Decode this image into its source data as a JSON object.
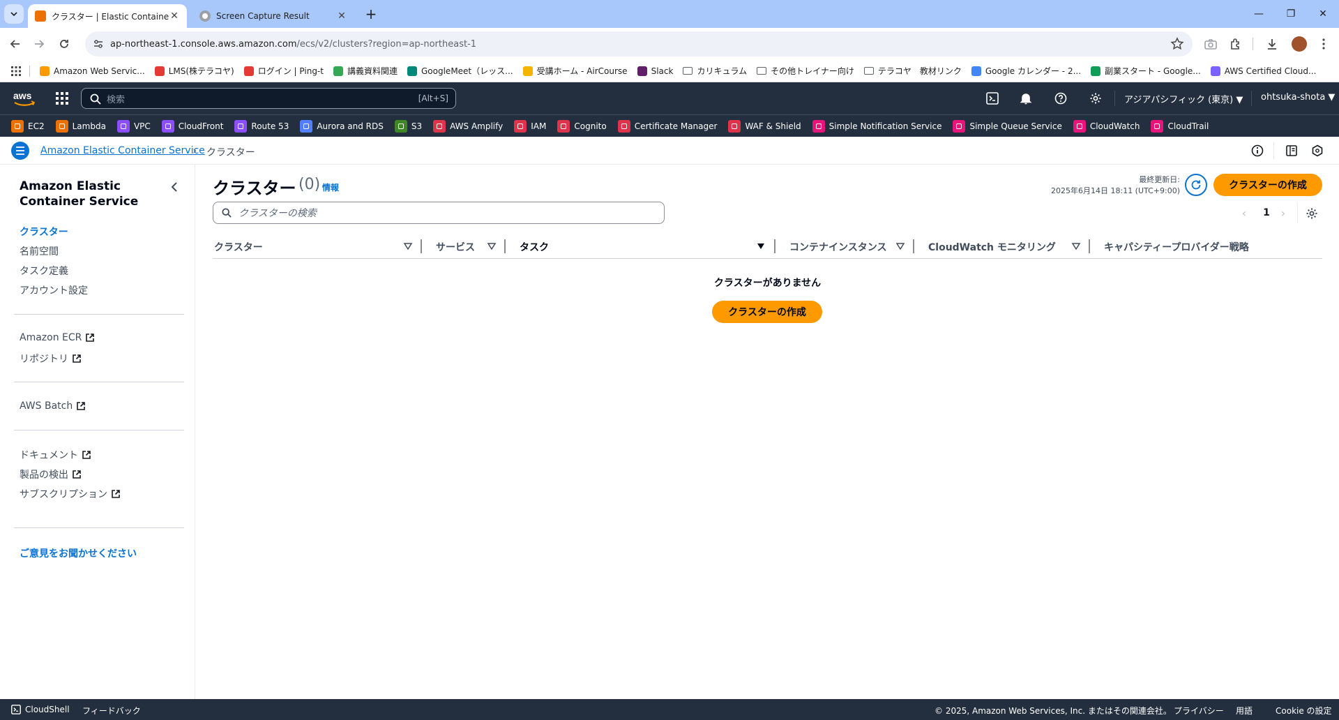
{
  "browser": {
    "tabs": [
      {
        "title": "クラスター | Elastic Container Servi",
        "active": true
      },
      {
        "title": "Screen Capture Result",
        "active": false
      }
    ],
    "url_host": "ap-northeast-1.console.aws.amazon.com",
    "url_path": "/ecs/v2/clusters?region=ap-northeast-1",
    "bookmarks": [
      {
        "label": "Amazon Web Servic...",
        "icon": "aws-cube-icon",
        "color": "#ff9900"
      },
      {
        "label": "LMS(株テラコヤ)",
        "icon": "lms-icon",
        "color": "#e53935"
      },
      {
        "label": "ログイン | Ping-t",
        "icon": "ping-t-icon",
        "color": "#e53935"
      },
      {
        "label": "講義資料関連",
        "icon": "google-drive-icon",
        "color": "#34a853"
      },
      {
        "label": "GoogleMeet（レッス...",
        "icon": "google-meet-icon",
        "color": "#00897b"
      },
      {
        "label": "受講ホーム - AirCourse",
        "icon": "aircourse-icon",
        "color": "#f4b400"
      },
      {
        "label": "Slack",
        "icon": "slack-icon",
        "color": "#611f69"
      },
      {
        "label": "カリキュラム",
        "icon": "folder-icon",
        "color": ""
      },
      {
        "label": "その他トレイナー向け",
        "icon": "folder-icon",
        "color": ""
      },
      {
        "label": "テラコヤ　教材リンク",
        "icon": "folder-icon",
        "color": ""
      },
      {
        "label": "Google カレンダー - 2...",
        "icon": "google-calendar-icon",
        "color": "#4285f4"
      },
      {
        "label": "副業スタート - Google...",
        "icon": "google-sheets-icon",
        "color": "#0f9d58"
      },
      {
        "label": "AWS Certified Cloud...",
        "icon": "aws-cert-icon",
        "color": "#7b61ff"
      }
    ]
  },
  "aws_header": {
    "search_placeholder": "検索",
    "search_shortcut": "[Alt+S]",
    "region": "アジアパシフィック (東京) ▼",
    "account": "ohtsuka-shota ▼"
  },
  "favorites": [
    {
      "label": "EC2",
      "color": "#ed7100"
    },
    {
      "label": "Lambda",
      "color": "#ed7100"
    },
    {
      "label": "VPC",
      "color": "#8c4fff"
    },
    {
      "label": "CloudFront",
      "color": "#8c4fff"
    },
    {
      "label": "Route 53",
      "color": "#8c4fff"
    },
    {
      "label": "Aurora and RDS",
      "color": "#527fff"
    },
    {
      "label": "S3",
      "color": "#3f8624"
    },
    {
      "label": "AWS Amplify",
      "color": "#dd344c"
    },
    {
      "label": "IAM",
      "color": "#dd344c"
    },
    {
      "label": "Cognito",
      "color": "#dd344c"
    },
    {
      "label": "Certificate Manager",
      "color": "#dd344c"
    },
    {
      "label": "WAF & Shield",
      "color": "#dd344c"
    },
    {
      "label": "Simple Notification Service",
      "color": "#e7157b"
    },
    {
      "label": "Simple Queue Service",
      "color": "#e7157b"
    },
    {
      "label": "CloudWatch",
      "color": "#e7157b"
    },
    {
      "label": "CloudTrail",
      "color": "#e7157b"
    }
  ],
  "breadcrumb": {
    "service": "Amazon Elastic Container Service",
    "current": "クラスター"
  },
  "sidenav": {
    "title": "Amazon Elastic Container Service",
    "items": [
      "クラスター",
      "名前空間",
      "タスク定義",
      "アカウント設定"
    ],
    "ecr": "Amazon ECR",
    "repositories": "リポジトリ",
    "batch": "AWS Batch",
    "docs": "ドキュメント",
    "discover": "製品の検出",
    "subscriptions": "サブスクリプション",
    "feedback": "ご意見をお聞かせください"
  },
  "main": {
    "title": "クラスター",
    "count": "(0)",
    "info": "情報",
    "last_updated_label": "最終更新日:",
    "last_updated_value": "2025年6月14日 18:11 (UTC+9:00)",
    "create_label": "クラスターの作成",
    "search_placeholder": "クラスターの検索",
    "page": "1",
    "columns": [
      "クラスター",
      "サービス",
      "タスク",
      "コンテナインスタンス",
      "CloudWatch モニタリング",
      "キャパシティープロバイダー戦略"
    ],
    "empty_title": "クラスターがありません",
    "empty_create": "クラスターの作成"
  },
  "footer": {
    "cloudshell": "CloudShell",
    "feedback": "フィードバック",
    "copyright": "© 2025, Amazon Web Services, Inc. またはその関連会社。",
    "privacy": "プライバシー",
    "terms": "用語",
    "cookie": "Cookie の設定"
  },
  "colors": {
    "aws_squid": "#232f3e",
    "link_blue": "#0972d3",
    "primary_orange": "#ff9900",
    "chrome_tabstrip": "#a8c7fa"
  }
}
